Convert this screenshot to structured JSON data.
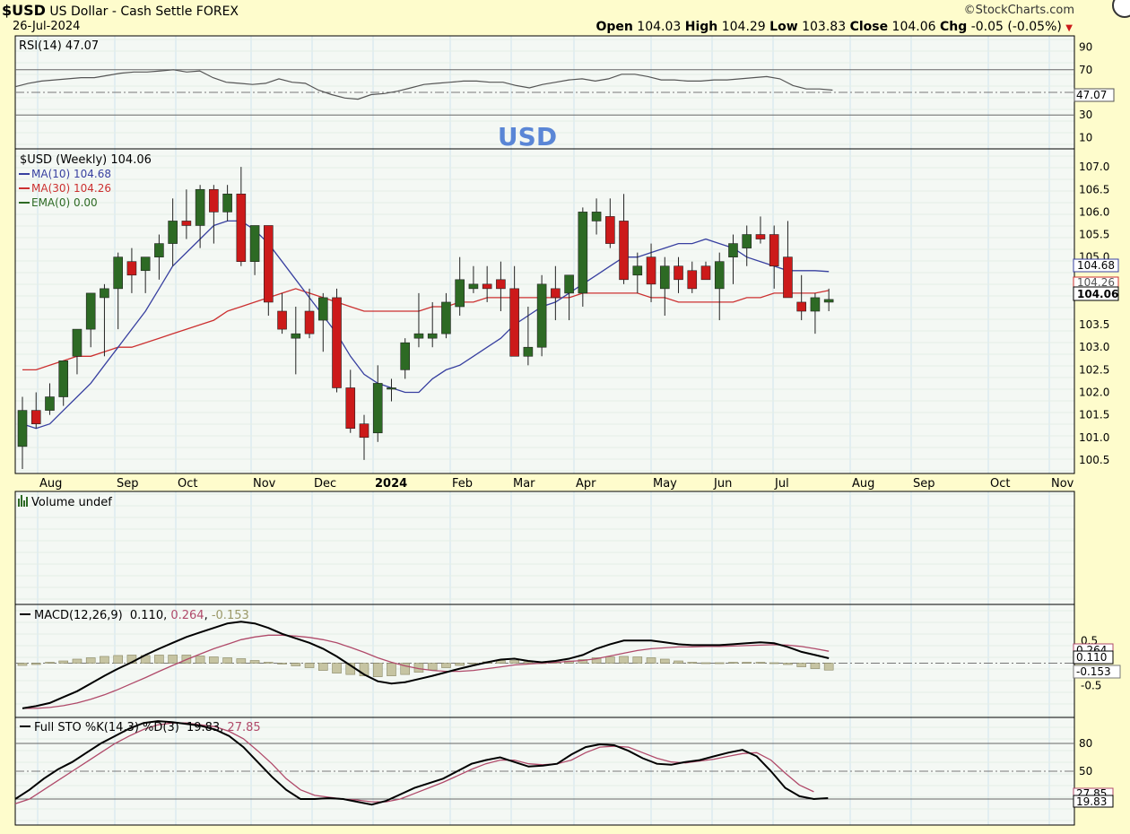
{
  "header": {
    "symbol": "$USD",
    "name": "US Dollar - Cash Settle FOREX",
    "date": "26-Jul-2024",
    "brand": "©StockCharts.com",
    "open_label": "Open",
    "open": "104.03",
    "high_label": "High",
    "high": "104.29",
    "low_label": "Low",
    "low": "103.83",
    "close_label": "Close",
    "close": "104.06",
    "chg_label": "Chg",
    "chg": "-0.05 (-0.05%)"
  },
  "watermark": "USD",
  "colors": {
    "background": "#fefccc",
    "panel": "#f4f8f4",
    "grid": "#cfe3ee",
    "up": "#2d6a24",
    "down": "#cc1a1a",
    "ma10": "#3840a0",
    "ma30": "#cc3030",
    "watermark": "#5a86d6",
    "volume_bar": "#c6c4a2",
    "signal": "#b04a6a",
    "hist_text": "#9a9868"
  },
  "chart_data": [
    {
      "type": "line",
      "panel": "rsi",
      "title": "RSI(14) 47.07",
      "ylim": [
        0,
        100
      ],
      "y_ticks": [
        "90",
        "70",
        "30",
        "10"
      ],
      "last_label": "47.07",
      "series": [
        {
          "name": "RSI(14)",
          "values": [
            55,
            58,
            60,
            61,
            62,
            63,
            63,
            65,
            67,
            68,
            68,
            69,
            70,
            68,
            69,
            63,
            59,
            58,
            57,
            58,
            62,
            59,
            58,
            52,
            48,
            45,
            44,
            48,
            49,
            51,
            54,
            57,
            58,
            59,
            60,
            60,
            59,
            59,
            56,
            54,
            57,
            59,
            61,
            62,
            60,
            62,
            66,
            66,
            64,
            61,
            61,
            60,
            60,
            61,
            61,
            62,
            63,
            64,
            62,
            56,
            53,
            53,
            52
          ]
        }
      ]
    },
    {
      "type": "candlestick",
      "panel": "price",
      "title": "$USD (Weekly) 104.06",
      "legend": [
        {
          "text": "MA(10) 104.68",
          "color": "#3840a0"
        },
        {
          "text": "MA(30) 104.26",
          "color": "#cc3030"
        },
        {
          "text": "EMA(0) 0.00",
          "color": "#2d6a24"
        }
      ],
      "ylim": [
        100.2,
        107.4
      ],
      "y_ticks": [
        "107.0",
        "106.5",
        "106.0",
        "105.5",
        "105.0",
        "103.5",
        "103.0",
        "102.5",
        "102.0",
        "101.5",
        "101.0",
        "100.5"
      ],
      "x_labels": [
        "Aug",
        "Sep",
        "Oct",
        "Nov",
        "Dec",
        "2024",
        "Feb",
        "Mar",
        "Apr",
        "May",
        "Jun",
        "Jul",
        "Aug",
        "Sep",
        "Oct",
        "Nov"
      ],
      "last_labels": {
        "ma10": "104.68",
        "ma30": "104.26",
        "close": "104.06"
      },
      "ohlc": [
        [
          100.8,
          101.9,
          100.3,
          101.6
        ],
        [
          101.6,
          102.0,
          101.2,
          101.3
        ],
        [
          101.6,
          102.2,
          101.5,
          101.9
        ],
        [
          101.9,
          102.7,
          101.7,
          102.7
        ],
        [
          102.8,
          103.4,
          102.4,
          103.4
        ],
        [
          103.4,
          104.2,
          103.0,
          104.2
        ],
        [
          104.1,
          104.4,
          102.8,
          104.3
        ],
        [
          104.3,
          105.1,
          103.4,
          105.0
        ],
        [
          104.9,
          105.2,
          104.2,
          104.6
        ],
        [
          104.7,
          105.0,
          104.2,
          105.0
        ],
        [
          105.0,
          105.5,
          104.5,
          105.3
        ],
        [
          105.3,
          106.3,
          104.8,
          105.8
        ],
        [
          105.8,
          106.5,
          105.4,
          105.7
        ],
        [
          105.7,
          106.6,
          105.2,
          106.5
        ],
        [
          106.5,
          106.6,
          105.3,
          106.0
        ],
        [
          106.0,
          106.6,
          105.8,
          106.4
        ],
        [
          106.4,
          107.0,
          104.8,
          104.9
        ],
        [
          104.9,
          105.7,
          104.6,
          105.7
        ],
        [
          105.7,
          105.7,
          103.7,
          104.0
        ],
        [
          103.8,
          104.2,
          103.3,
          103.4
        ],
        [
          103.2,
          103.9,
          102.4,
          103.3
        ],
        [
          103.8,
          104.3,
          103.2,
          103.3
        ],
        [
          103.6,
          104.2,
          102.9,
          104.1
        ],
        [
          104.1,
          104.3,
          102.0,
          102.1
        ],
        [
          102.1,
          102.5,
          101.1,
          101.2
        ],
        [
          101.3,
          101.5,
          100.5,
          101.0
        ],
        [
          101.1,
          102.6,
          100.9,
          102.2
        ],
        [
          102.1,
          102.3,
          101.8,
          102.1
        ],
        [
          102.5,
          103.2,
          102.3,
          103.1
        ],
        [
          103.2,
          104.2,
          103.0,
          103.3
        ],
        [
          103.2,
          104.0,
          103.0,
          103.3
        ],
        [
          103.3,
          104.2,
          103.2,
          104.0
        ],
        [
          103.9,
          105.0,
          103.7,
          104.5
        ],
        [
          104.3,
          104.8,
          104.2,
          104.4
        ],
        [
          104.4,
          104.8,
          104.0,
          104.3
        ],
        [
          104.5,
          104.9,
          103.8,
          104.3
        ],
        [
          104.3,
          104.8,
          102.8,
          102.8
        ],
        [
          102.8,
          103.9,
          102.6,
          103.0
        ],
        [
          103.0,
          104.6,
          102.8,
          104.4
        ],
        [
          104.3,
          104.8,
          103.6,
          104.1
        ],
        [
          104.2,
          104.5,
          103.6,
          104.6
        ],
        [
          104.2,
          106.1,
          103.9,
          106.0
        ],
        [
          105.8,
          106.3,
          105.5,
          106.0
        ],
        [
          105.9,
          106.3,
          105.2,
          105.3
        ],
        [
          105.8,
          106.4,
          104.4,
          104.5
        ],
        [
          104.6,
          105.1,
          104.2,
          104.8
        ],
        [
          105.0,
          105.3,
          104.0,
          104.4
        ],
        [
          104.3,
          105.0,
          103.7,
          104.8
        ],
        [
          104.8,
          105.0,
          104.2,
          104.5
        ],
        [
          104.7,
          104.9,
          104.2,
          104.3
        ],
        [
          104.8,
          104.9,
          104.5,
          104.5
        ],
        [
          104.3,
          105.1,
          103.6,
          104.9
        ],
        [
          105.0,
          105.5,
          104.4,
          105.3
        ],
        [
          105.2,
          105.7,
          104.8,
          105.5
        ],
        [
          105.5,
          105.9,
          105.3,
          105.4
        ],
        [
          105.5,
          105.7,
          104.3,
          104.8
        ],
        [
          105.0,
          105.8,
          104.2,
          104.1
        ],
        [
          104.0,
          104.6,
          103.6,
          103.8
        ],
        [
          103.8,
          104.2,
          103.3,
          104.1
        ],
        [
          104.0,
          104.3,
          103.8,
          104.06
        ]
      ],
      "ma10": [
        101.3,
        101.2,
        101.3,
        101.6,
        101.9,
        102.2,
        102.6,
        103.0,
        103.4,
        103.8,
        104.3,
        104.8,
        105.1,
        105.4,
        105.7,
        105.8,
        105.8,
        105.6,
        105.3,
        104.9,
        104.5,
        104.1,
        103.7,
        103.3,
        102.8,
        102.4,
        102.2,
        102.1,
        102.0,
        102.0,
        102.3,
        102.5,
        102.6,
        102.8,
        103.0,
        103.2,
        103.5,
        103.7,
        103.9,
        104.0,
        104.2,
        104.4,
        104.6,
        104.8,
        105.0,
        105.0,
        105.1,
        105.2,
        105.3,
        105.3,
        105.4,
        105.3,
        105.2,
        105.0,
        104.9,
        104.8,
        104.7,
        104.7,
        104.7,
        104.68
      ],
      "ma30": [
        102.5,
        102.5,
        102.6,
        102.7,
        102.8,
        102.8,
        102.9,
        103.0,
        103.0,
        103.1,
        103.2,
        103.3,
        103.4,
        103.5,
        103.6,
        103.8,
        103.9,
        104.0,
        104.1,
        104.2,
        104.3,
        104.2,
        104.1,
        104.0,
        103.9,
        103.8,
        103.8,
        103.8,
        103.8,
        103.8,
        103.9,
        103.9,
        104.0,
        104.0,
        104.1,
        104.1,
        104.1,
        104.1,
        104.1,
        104.1,
        104.1,
        104.2,
        104.2,
        104.2,
        104.2,
        104.2,
        104.1,
        104.1,
        104.0,
        104.0,
        104.0,
        104.0,
        104.0,
        104.1,
        104.1,
        104.2,
        104.2,
        104.2,
        104.2,
        104.26
      ]
    },
    {
      "type": "bar",
      "panel": "volume",
      "title": "Volume undef",
      "values": []
    },
    {
      "type": "line",
      "panel": "macd",
      "title": "MACD(12,26,9)",
      "title_values": [
        "0.110",
        "0.264",
        "-0.153"
      ],
      "ylim": [
        -1.2,
        1.3
      ],
      "y_ticks": [
        "0.5",
        "-0.5"
      ],
      "last_labels": {
        "signal": "0.264",
        "macd": "0.110",
        "histogram": "-0.153"
      },
      "series": [
        {
          "name": "MACD(12,26,9)",
          "values": [
            -1.0,
            -0.95,
            -0.88,
            -0.75,
            -0.62,
            -0.45,
            -0.28,
            -0.12,
            0.02,
            0.18,
            0.32,
            0.45,
            0.58,
            0.68,
            0.78,
            0.88,
            0.92,
            0.88,
            0.78,
            0.65,
            0.55,
            0.45,
            0.32,
            0.15,
            -0.05,
            -0.25,
            -0.4,
            -0.45,
            -0.42,
            -0.35,
            -0.28,
            -0.2,
            -0.12,
            -0.05,
            0.02,
            0.08,
            0.1,
            0.05,
            0.02,
            0.05,
            0.1,
            0.18,
            0.32,
            0.42,
            0.5,
            0.5,
            0.5,
            0.46,
            0.42,
            0.4,
            0.4,
            0.4,
            0.42,
            0.44,
            0.46,
            0.44,
            0.36,
            0.25,
            0.18,
            0.11
          ]
        },
        {
          "name": "Signal",
          "values": [
            -1.0,
            -1.0,
            -0.98,
            -0.94,
            -0.88,
            -0.8,
            -0.7,
            -0.58,
            -0.45,
            -0.32,
            -0.18,
            -0.05,
            0.08,
            0.2,
            0.32,
            0.42,
            0.52,
            0.58,
            0.62,
            0.62,
            0.6,
            0.57,
            0.52,
            0.45,
            0.35,
            0.24,
            0.12,
            0.02,
            -0.06,
            -0.12,
            -0.16,
            -0.18,
            -0.18,
            -0.16,
            -0.12,
            -0.08,
            -0.04,
            -0.02,
            0.0,
            0.02,
            0.04,
            0.06,
            0.1,
            0.16,
            0.22,
            0.28,
            0.32,
            0.34,
            0.36,
            0.36,
            0.37,
            0.37,
            0.38,
            0.39,
            0.4,
            0.41,
            0.4,
            0.37,
            0.32,
            0.264
          ]
        },
        {
          "name": "Histogram",
          "values": [
            -0.05,
            -0.03,
            0.02,
            0.05,
            0.09,
            0.12,
            0.15,
            0.17,
            0.18,
            0.17,
            0.18,
            0.18,
            0.18,
            0.16,
            0.14,
            0.12,
            0.1,
            0.06,
            0.02,
            -0.02,
            -0.06,
            -0.1,
            -0.16,
            -0.22,
            -0.25,
            -0.28,
            -0.3,
            -0.28,
            -0.25,
            -0.2,
            -0.15,
            -0.1,
            -0.05,
            -0.01,
            0.03,
            0.06,
            0.06,
            0.03,
            0.01,
            0.02,
            0.05,
            0.08,
            0.12,
            0.14,
            0.15,
            0.14,
            0.12,
            0.09,
            0.05,
            0.02,
            0.01,
            0.01,
            0.02,
            0.02,
            0.02,
            0.01,
            -0.03,
            -0.08,
            -0.12,
            -0.153
          ]
        }
      ]
    },
    {
      "type": "line",
      "panel": "sto",
      "title": "Full STO %K(14,3) %D(3)",
      "title_values": [
        "19.83",
        "27.85"
      ],
      "ylim": [
        -8,
        108
      ],
      "y_ticks": [
        "80",
        "50"
      ],
      "last_labels": {
        "d": "27.85",
        "k": "19.83"
      },
      "series": [
        {
          "name": "%K(14,3)",
          "values": [
            20,
            30,
            42,
            52,
            60,
            70,
            80,
            88,
            96,
            102,
            104,
            103,
            101,
            99,
            95,
            88,
            76,
            60,
            44,
            30,
            20,
            20,
            21,
            20,
            17,
            14,
            18,
            25,
            32,
            37,
            42,
            50,
            58,
            62,
            65,
            60,
            55,
            56,
            58,
            68,
            76,
            79,
            78,
            72,
            64,
            58,
            57,
            60,
            62,
            66,
            70,
            73,
            66,
            50,
            32,
            23,
            20,
            21
          ]
        },
        {
          "name": "%D(3)",
          "values": [
            15,
            20,
            30,
            40,
            50,
            60,
            70,
            80,
            88,
            95,
            100,
            102,
            102,
            100,
            98,
            93,
            85,
            72,
            58,
            42,
            30,
            24,
            22,
            20,
            19,
            17,
            17,
            20,
            26,
            32,
            38,
            45,
            52,
            58,
            62,
            62,
            58,
            57,
            58,
            62,
            70,
            76,
            77,
            76,
            70,
            64,
            60,
            59,
            61,
            63,
            66,
            69,
            70,
            62,
            48,
            35,
            27.85
          ]
        }
      ]
    }
  ]
}
